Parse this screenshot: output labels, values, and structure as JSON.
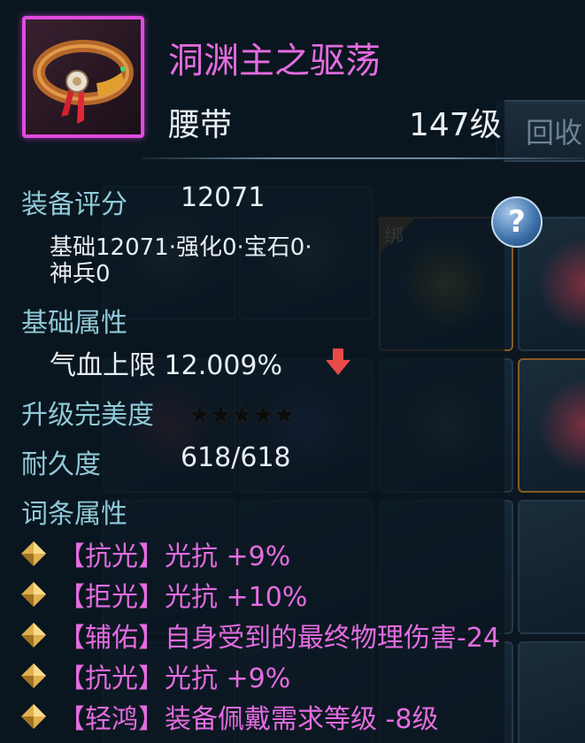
{
  "background": {
    "bind_label": "绑",
    "recycle_button": "回收"
  },
  "item": {
    "name": "洞渊主之驱荡",
    "type": "腰带",
    "level": "147级",
    "rarity_color": "#e04ae0"
  },
  "stats": {
    "score_label": "装备评分",
    "score_value": "12071",
    "score_breakdown_line1": "基础12071·强化0·宝石0·",
    "score_breakdown_line2": "神兵0",
    "base_attr_label": "基础属性",
    "base_attr_value": "气血上限 12.009%",
    "base_attr_trend": "down",
    "perfection_label": "升级完美度",
    "perfection_stars": 0,
    "perfection_max_stars": 5,
    "durability_label": "耐久度",
    "durability_value": "618/618",
    "affix_label": "词条属性"
  },
  "affixes": [
    {
      "text": "【抗光】光抗 +9%"
    },
    {
      "text": "【拒光】光抗 +10%"
    },
    {
      "text": "【辅佑】自身受到的最终物理伤害-24"
    },
    {
      "text": "【抗光】光抗 +9%"
    },
    {
      "text": "【轻鸿】装备佩戴需求等级 -8级"
    }
  ],
  "colors": {
    "name": "#e46ce0",
    "label": "#8fc9d8",
    "value": "#e8eef2",
    "affix": "#e46ce0",
    "trend_down": "#e84a4a"
  },
  "icons": {
    "help": "question-circle-icon",
    "trend": "arrow-down-icon",
    "affix_bullet": "gold-diamond-icon"
  }
}
